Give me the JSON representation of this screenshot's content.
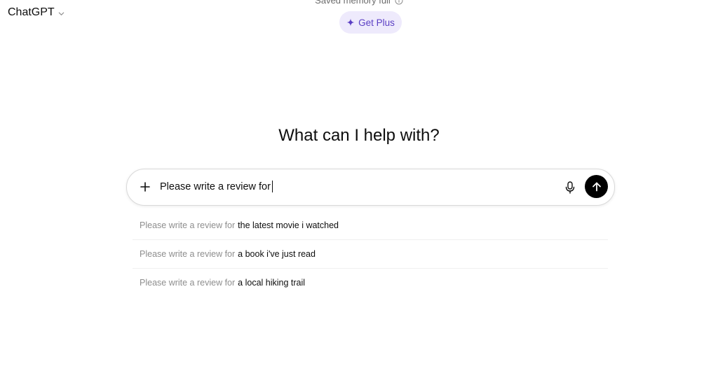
{
  "header": {
    "model_name": "ChatGPT",
    "memory_banner": "Saved memory full",
    "get_plus_label": "Get Plus"
  },
  "main": {
    "headline": "What can I help with?"
  },
  "composer": {
    "input_value": "Please write a review for"
  },
  "suggestions": [
    {
      "prefix": "Please write a review for",
      "completion": "the latest movie i watched"
    },
    {
      "prefix": "Please write a review for",
      "completion": "a book i've just read"
    },
    {
      "prefix": "Please write a review for",
      "completion": "a local hiking trail"
    }
  ],
  "colors": {
    "accent": "#5b3fc4",
    "accent_bg": "#eeeafc",
    "send_button": "#000000"
  },
  "icons": {
    "chevron": "chevron-down-icon",
    "info": "info-icon",
    "sparkle": "sparkle-icon",
    "plus": "plus-icon",
    "mic": "microphone-icon",
    "send": "arrow-up-icon"
  }
}
